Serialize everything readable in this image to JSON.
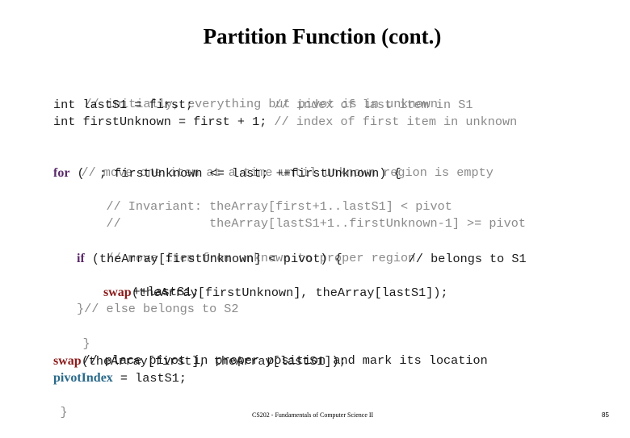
{
  "slide": {
    "title": "Partition Function (cont.)",
    "footer": "CS202 - Fundamentals of Computer Science II",
    "page_number": "85"
  },
  "code": {
    "l1_comment": "// initially, everything but pivot is in unknown",
    "l2_code": "int lastS1 = first;           ",
    "l2_comment": "// index of last item in S1",
    "l3_code": "int firstUnknown = first + 1; ",
    "l3_comment": "// index of first item in unknown",
    "l4_comment": "// move one item at a time until unknown region is empty",
    "l5_kw": "for",
    "l5_code": " (  ; firstUnknown <= last; ++firstUnknown) {",
    "l6_comment": "// Invariant: theArray[first+1..lastS1] < pivot",
    "l7_comment": "//            theArray[lastS1+1..firstUnknown-1] >= pivot",
    "l8_comment": "// move item from unknown to proper region",
    "l9_kw": "if",
    "l9_code": " (theArray[firstUnknown] < pivot) {         ",
    "l9_comment": "// belongs to S1",
    "l10_code": "++lastS1;",
    "l11_fn": "swap",
    "l11_code": "(theArray[firstUnknown], theArray[lastS1]);",
    "l12_code": "}",
    "l12_comment": "// else belongs to S2",
    "l13_code": "}",
    "l14_comment": "// place pivot in proper position and mark its location",
    "l15_fn": "swap",
    "l15_code": "(theArray[first], theArray[lastS1]);",
    "l16_var": "pivotIndex",
    "l16_code": " = lastS1;",
    "l17_code": "}"
  }
}
